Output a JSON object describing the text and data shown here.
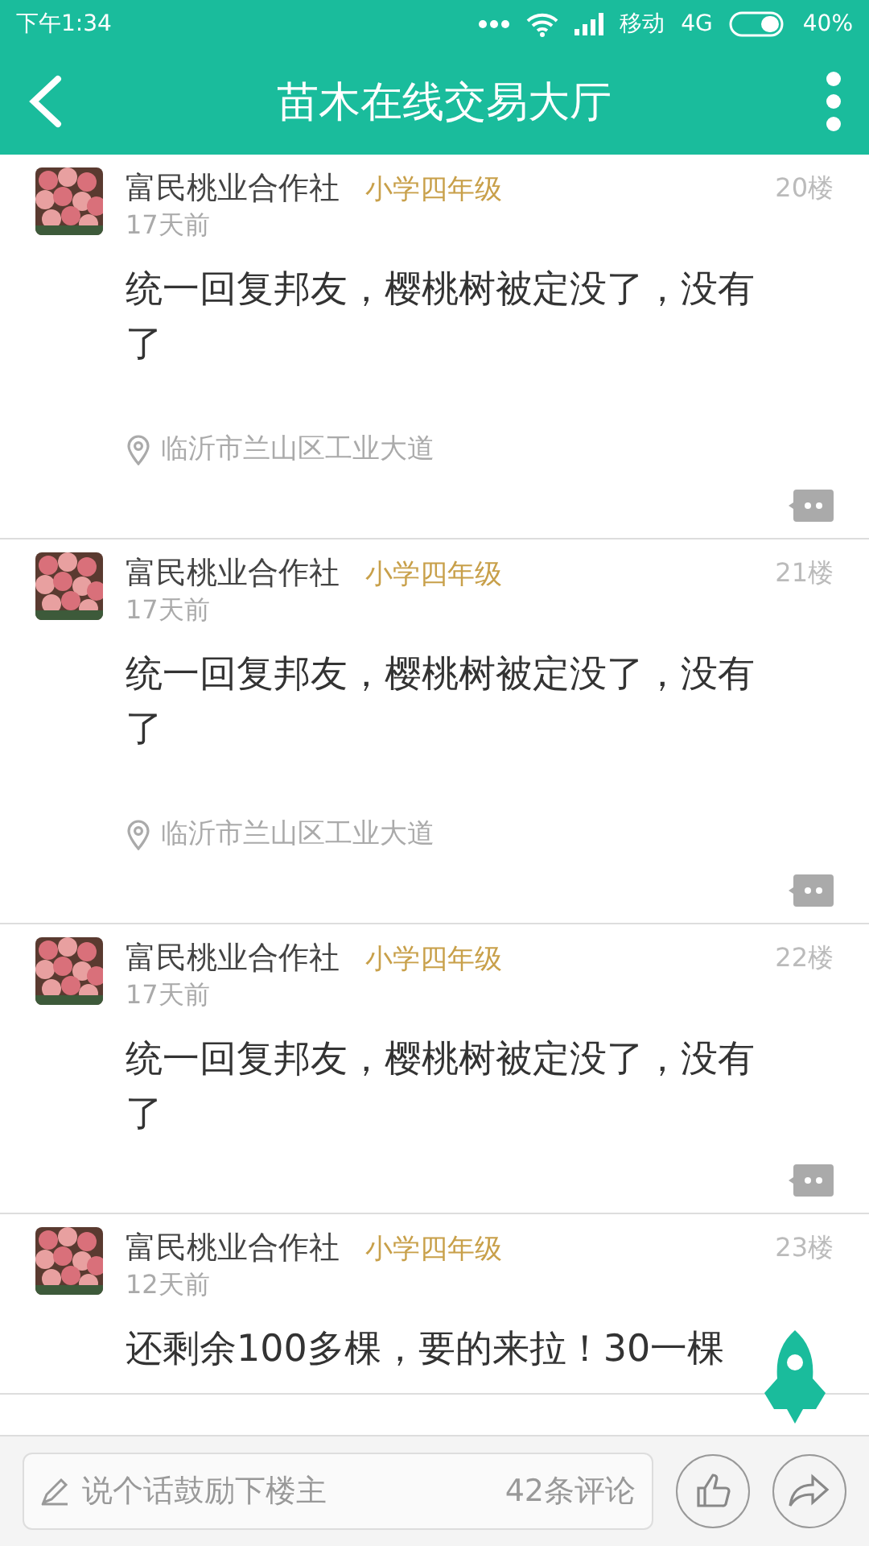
{
  "status_bar": {
    "time": "下午1:34",
    "carrier": "移动",
    "network": "4G",
    "battery": "40%"
  },
  "header": {
    "title": "苗木在线交易大厅"
  },
  "posts": [
    {
      "author": "富民桃业合作社",
      "rank": "小学四年级",
      "time": "17天前",
      "floor": "20楼",
      "text": "统一回复邦友，樱桃树被定没了，没有了",
      "location": "临沂市兰山区工业大道"
    },
    {
      "author": "富民桃业合作社",
      "rank": "小学四年级",
      "time": "17天前",
      "floor": "21楼",
      "text": "统一回复邦友，樱桃树被定没了，没有了",
      "location": "临沂市兰山区工业大道"
    },
    {
      "author": "富民桃业合作社",
      "rank": "小学四年级",
      "time": "17天前",
      "floor": "22楼",
      "text": "统一回复邦友，樱桃树被定没了，没有了"
    },
    {
      "author": "富民桃业合作社",
      "rank": "小学四年级",
      "time": "12天前",
      "floor": "23楼",
      "text": "还剩余100多棵，要的来拉！30一棵"
    }
  ],
  "comment_bar": {
    "placeholder": "说个话鼓励下楼主",
    "count": "42条评论"
  }
}
